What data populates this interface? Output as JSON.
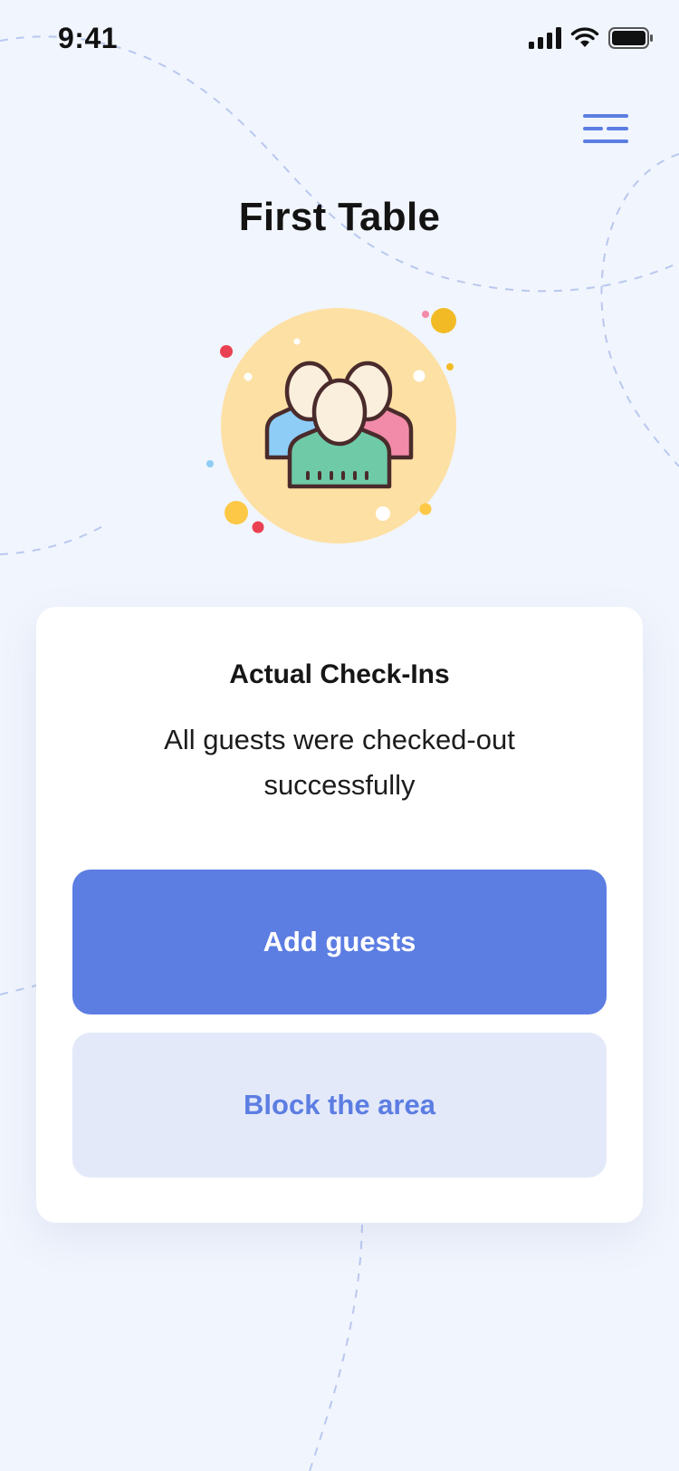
{
  "status_bar": {
    "time": "9:41",
    "icons": [
      "cellular-signal-icon",
      "wifi-icon",
      "battery-icon"
    ]
  },
  "header": {
    "menu_icon": "hamburger-menu-icon",
    "title": "First Table"
  },
  "illustration": {
    "icon": "guests-group-icon"
  },
  "card": {
    "heading": "Actual Check-Ins",
    "message": "All guests were checked-out successfully",
    "primary_button": "Add guests",
    "secondary_button": "Block the area"
  },
  "colors": {
    "background": "#f1f5fd",
    "accent": "#5c7de2",
    "accent_light": "#e3e9f9",
    "card": "#ffffff",
    "illustration_circle": "#fde0a4"
  }
}
